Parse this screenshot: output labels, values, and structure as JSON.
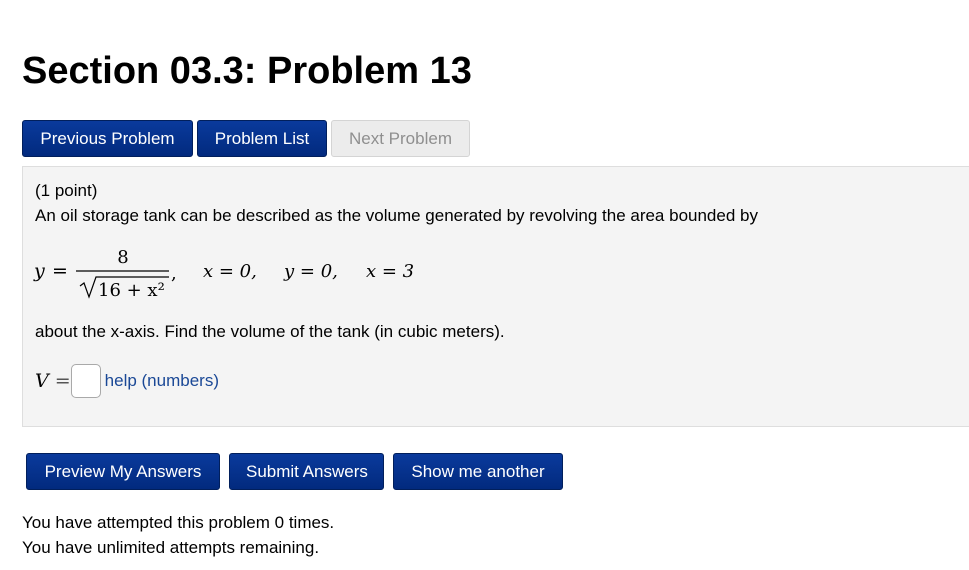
{
  "page": {
    "title": "Section 03.3: Problem 13"
  },
  "nav": {
    "previous_label": "Previous Problem",
    "list_label": "Problem List",
    "next_label": "Next Problem"
  },
  "problem": {
    "points": "(1 point)",
    "intro": "An oil storage tank can be described as the volume generated by revolving the area bounded by",
    "equation": {
      "lhs": "y",
      "equals": "=",
      "numerator": "8",
      "radicand": "16 + x²",
      "comma": ",",
      "b1": "x = 0,",
      "b2": "y = 0,",
      "b3": "x = 3"
    },
    "about": "about the x-axis. Find the volume of the tank (in cubic meters).",
    "answer": {
      "label": "V",
      "equals": "=",
      "value": "",
      "help_label": "help (numbers)"
    }
  },
  "actions": {
    "preview_label": "Preview My Answers",
    "submit_label": "Submit Answers",
    "another_label": "Show me another"
  },
  "status": {
    "attempts": "You have attempted this problem 0 times.",
    "remaining": "You have unlimited attempts remaining."
  },
  "colors": {
    "button_blue": "#022a7e",
    "disabled_button": "#ececec",
    "problem_background": "#f4f4f4",
    "link": "#1a4896"
  }
}
